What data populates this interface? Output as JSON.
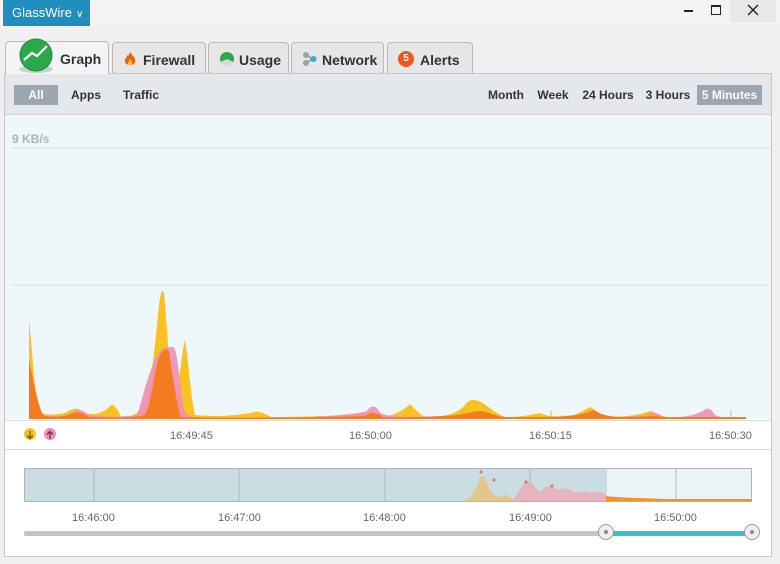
{
  "app": {
    "name": "GlassWire"
  },
  "tabs": [
    {
      "label": "Graph",
      "icon": "graph-icon",
      "active": true
    },
    {
      "label": "Firewall",
      "icon": "fire-icon"
    },
    {
      "label": "Usage",
      "icon": "pie-icon"
    },
    {
      "label": "Network",
      "icon": "network-icon"
    },
    {
      "label": "Alerts",
      "icon": "alert-badge-icon",
      "badge": "5"
    }
  ],
  "filters": {
    "all": "All",
    "apps": "Apps",
    "traffic": "Traffic",
    "selected": "All"
  },
  "ranges": {
    "items": [
      "Month",
      "Week",
      "24 Hours",
      "3 Hours",
      "5 Minutes"
    ],
    "selected": "5 Minutes"
  },
  "chart_data": {
    "type": "area",
    "ylabel": "9 KB/s",
    "x_ticks": [
      "16:49:45",
      "16:50:00",
      "16:50:15",
      "16:50:30"
    ],
    "series": [
      {
        "role": "incoming",
        "color": "#f9c221"
      },
      {
        "role": "outgoing",
        "color": "#ee8fb5"
      },
      {
        "role": "combined",
        "color": "#f47c1f"
      }
    ]
  },
  "timeline": {
    "ticks": [
      "16:46:00",
      "16:47:00",
      "16:48:00",
      "16:49:00",
      "16:50:00"
    ]
  },
  "colors": {
    "accent": "#1f8dbd",
    "incoming": "#f9c221",
    "outgoing": "#ee8fb5",
    "combined": "#f47c1f",
    "slider": "#39c0cd"
  }
}
